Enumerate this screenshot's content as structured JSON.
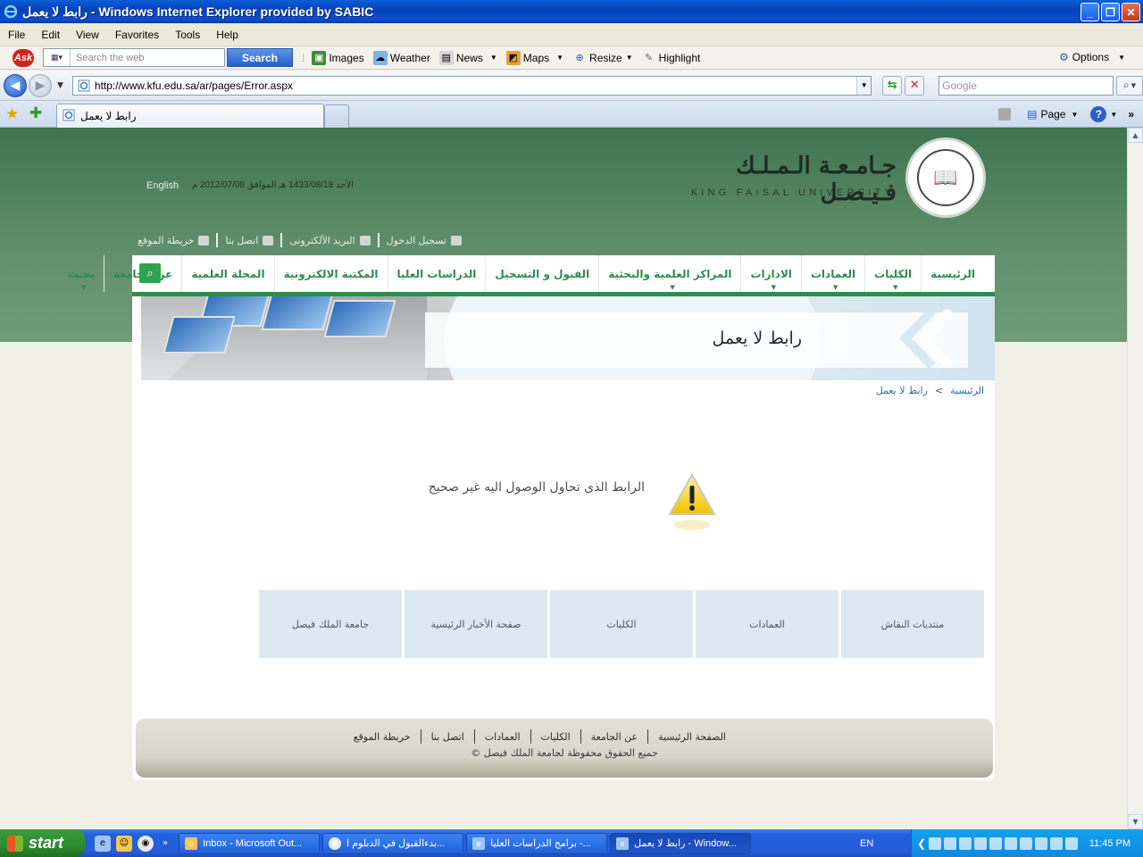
{
  "window": {
    "title": "رابط لا يعمل - Windows Internet Explorer provided by SABIC"
  },
  "menu": [
    "File",
    "Edit",
    "View",
    "Favorites",
    "Tools",
    "Help"
  ],
  "ask_toolbar": {
    "search_placeholder": "Search the web",
    "search_button": "Search",
    "tools": [
      "Images",
      "Weather",
      "News",
      "Maps",
      "Resize",
      "Highlight"
    ],
    "options": "Options"
  },
  "address": {
    "url": "http://www.kfu.edu.sa/ar/pages/Error.aspx",
    "google_placeholder": "Google"
  },
  "tab": {
    "title": "رابط لا يعمل"
  },
  "command_bar": {
    "page": "Page"
  },
  "site": {
    "name_ar": "جـامـعـة الـمـلـك فـيـصـل",
    "name_en": "KING FAISAL UNIVERSITY",
    "english_link": "English",
    "date_text": "الأحد  1433/08/18 هـ  الموافق  2012/07/08 م",
    "top_links": [
      "تسجيل الدخول",
      "البريد الألكترونى",
      "اتصل بنا",
      "خريطة الموقع"
    ],
    "nav": [
      "الرئيسية",
      "الكليات",
      "العمادات",
      "الادارات",
      "المراكز العلمية والبحثية",
      "القبول و التسجيل",
      "الدراسات العليا",
      "المكتبة الالكترونية",
      "المجلة العلمية",
      "عن الجامعة",
      "بحـث"
    ],
    "banner_title": "رابط لا يعمل",
    "breadcrumb": [
      "الرئيسية",
      "رابط لا يعمل"
    ],
    "breadcrumb_sep": ">",
    "error_message": "الرابط الذى تحاول الوصول اليه غير صحيح",
    "quick_links": [
      "منتديات النقاش",
      "العمادات",
      "الكليات",
      "صفحة الأخبار الرئيسية",
      "جامعة الملك فيصل"
    ],
    "footer_links": [
      "الصفحة الرئيسية",
      "عن الجامعة",
      "الكليات",
      "العمادات",
      "اتصل بنا",
      "خريطة الموقع"
    ],
    "copyright": "© جميع الحقوق محفوظة لجامعة الملك فيصل"
  },
  "taskbar": {
    "start": "start",
    "tasks": [
      "Inbox - Microsoft Out...",
      "بدءالقبول في الدبلوم ا...",
      "برامج الدراسات العليا -...",
      "رابط لا يعمل - Window..."
    ],
    "lang": "EN",
    "clock": "11:45 PM"
  },
  "colors": {
    "nav_green": "#2f8d4a",
    "header_green": "#5b8c66",
    "xp_blue": "#245edb"
  }
}
